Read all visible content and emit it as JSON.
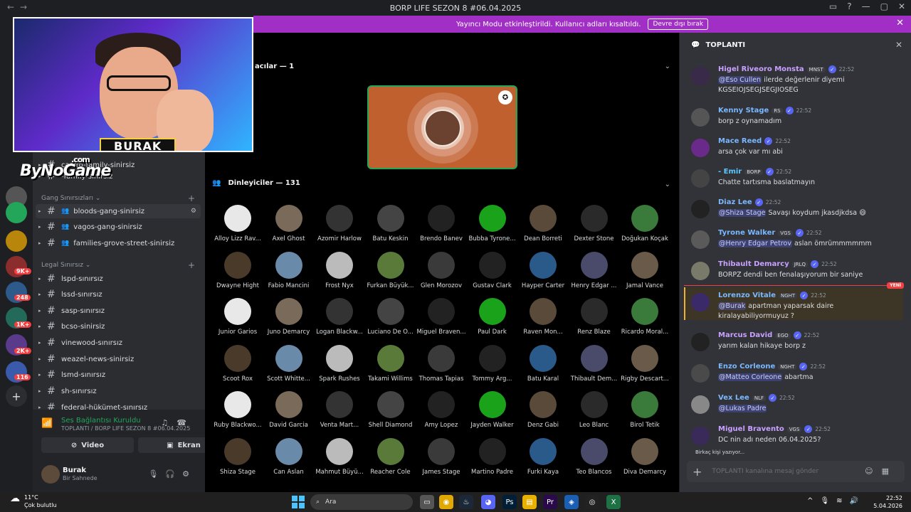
{
  "window": {
    "title": "BORP LIFE SEZON 8 #06.04.2025"
  },
  "banner": {
    "text": "Yayıncı Modu etkinleştirildi. Kullanıcı adları kısaltıldı.",
    "button": "Devre dışı bırak"
  },
  "overlay": {
    "streamer_name": "BURAK",
    "watermark": "ByNoGame",
    "watermark_domain": ".com"
  },
  "server_badges": [
    "9K+",
    "248",
    "1K+",
    "2K+",
    "116"
  ],
  "channels": {
    "partial_top": "castro-family-sinirsiz",
    "partial_second": "-family-sinirsiz",
    "categories": [
      {
        "name": "Gang Sınırsızları",
        "items": [
          "bloods-gang-sinirsiz",
          "vagos-gang-sinirsiz",
          "families-grove-street-sinirsiz"
        ]
      },
      {
        "name": "Legal Sınırsız",
        "items": [
          "lspd-sınırsız",
          "lssd-sınırsız",
          "sasp-sınırsız",
          "bcso-sinirsiz",
          "vinewood-sınırsız",
          "weazel-news-sinirsiz",
          "lsmd-sınırsız",
          "sh-sınırsız",
          "federal-hükümet-sınırsız"
        ]
      }
    ]
  },
  "voice": {
    "status": "Ses Bağlantısı Kuruldu",
    "channel": "TOPLANTI / BORP LIFE SEZON 8 #06.04.2025",
    "video_label": "Video",
    "screen_label": "Ekran"
  },
  "user": {
    "name": "Burak",
    "status": "Bir Sahnede"
  },
  "stage": {
    "speakers_header": "acılar — 1",
    "listeners_header": "Dinleyiciler — 131",
    "audience": [
      "Alloy Lizz Rav...",
      "Axel Ghost",
      "Azomir Harlow",
      "Batu Keskin",
      "Brendo Banev",
      "Bubba Tyrone...",
      "Dean Borreti",
      "Dexter Stone",
      "Doğukan Koçak",
      "Dwayne Hight",
      "Fabio Mancini",
      "Frost Nyx",
      "Furkan Büyük...",
      "Glen Morozov",
      "Gustav Clark",
      "Hayper Carter",
      "Henry Edgar ...",
      "Jamal Vance",
      "Junior Garios",
      "Juno Demarcy",
      "Logan Blackw...",
      "Luciano De O...",
      "Miguel Braven...",
      "Paul Dark",
      "Raven Mon...",
      "Renz Blaze",
      "Ricardo Moral...",
      "Scoot Rox",
      "Scott Whitte...",
      "Spark Rushes",
      "Takami Willims",
      "Thomas Tapias",
      "Tommy Arg...",
      "Batu Karal",
      "Thibault Dem...",
      "Rigby Descart...",
      "Ruby Blackwo...",
      "David Garcia",
      "Venta Mart...",
      "Shell Diamond",
      "Amy Lopez",
      "Jayden Walker",
      "Denz Gabi",
      "Leo Blanc",
      "Birol Tetik",
      "Shiza Stage",
      "Can Aslan",
      "Mahmut Büyü...",
      "Reacher Cole",
      "James Stage",
      "Martino Padre",
      "Furki Kaya",
      "Teo Blancos",
      "Diva Demarcy"
    ]
  },
  "chat": {
    "channel": "TOPLANTI",
    "messages": [
      {
        "user": "Higel Riveoro Monsta",
        "tag": "MNST",
        "time": "22:52",
        "mention": "@Eso Cullen",
        "text": " ilerde değerlenir diyemi KGSEIOJSEGJSEGJIOSEG",
        "color": "#c9a0ff"
      },
      {
        "user": "Kenny Stage",
        "tag": "RS",
        "time": "22:52",
        "mention": "",
        "text": "borp z oynamadım",
        "color": "#7ab8ff"
      },
      {
        "user": "Mace Reed",
        "tag": "",
        "time": "22:52",
        "mention": "",
        "text": "arsa çok var mı abi",
        "color": "#7ab8ff"
      },
      {
        "user": "- Emir",
        "tag": "BORP",
        "time": "22:52",
        "mention": "",
        "text": "Chatte tartısma baslatmayın",
        "color": "#5cc8ff"
      },
      {
        "user": "Diaz Lee",
        "tag": "",
        "time": "22:52",
        "mention": "@Shiza Stage",
        "text": " Savaşı koydum jkasdjkdsa 😄",
        "color": "#7ab8ff"
      },
      {
        "user": "Tyrone Walker",
        "tag": "VGS",
        "time": "22:52",
        "mention": "@Henry Edgar Petrov",
        "text": " aslan ömrümmmmmm",
        "color": "#7ab8ff"
      },
      {
        "user": "Thibault Demarcy",
        "tag": "JRLQ",
        "time": "22:52",
        "mention": "",
        "text": "BORPZ dendi ben fenalaşıyorum bir saniye",
        "color": "#c9a0ff"
      },
      {
        "user": "Lorenzo Vitale",
        "tag": "NGHT",
        "time": "22:52",
        "mention": "@Burak",
        "text": " apartman yaparsak daire kiralayabiliyormuyuz ?",
        "color": "#7ab8ff"
      },
      {
        "user": "Marcus David",
        "tag": "EGO",
        "time": "22:52",
        "mention": "",
        "text": "yarım kalan hikaye borp z",
        "color": "#c9a0ff"
      },
      {
        "user": "Enzo Corleone",
        "tag": "NGHT",
        "time": "22:52",
        "mention": "@Matteo Corleone",
        "text": " abartma",
        "color": "#7ab8ff"
      },
      {
        "user": "Vex Lee",
        "tag": "NLF",
        "time": "22:52",
        "mention": "@Lukas Padre",
        "text": "",
        "color": "#7ab8ff"
      },
      {
        "user": "Miguel Bravento",
        "tag": "VGS",
        "time": "22:52",
        "mention": "",
        "text": "DC nin adı neden 06.04.2025?",
        "color": "#c9a0ff"
      }
    ],
    "new_badge": "YENİ",
    "typing": "Birkaç kişi yazıyor...",
    "input_placeholder": "TOPLANTI kanalına mesaj gönder"
  },
  "taskbar": {
    "temp": "11°C",
    "weather": "Çok bulutlu",
    "search_placeholder": "Ara",
    "time": "22:52",
    "date": "5.04.2026"
  }
}
